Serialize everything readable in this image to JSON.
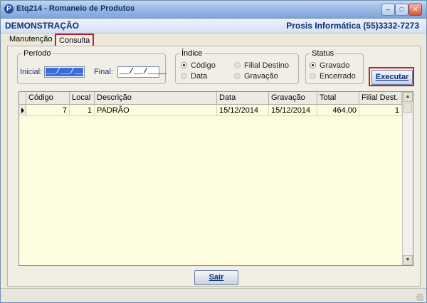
{
  "window": {
    "title": "Etq214 - Romaneio de Produtos",
    "app_icon": "P",
    "minimize": "–",
    "maximize": "□",
    "close": "✕"
  },
  "brand": {
    "left": "DEMONSTRAÇÃO",
    "right": "Prosis Informática (55)3332-7273"
  },
  "tabs": [
    {
      "label": "Manutenção",
      "active": false
    },
    {
      "label": "Consulta",
      "active": true
    }
  ],
  "periodo": {
    "legend": "Período",
    "inicial_label": "Inicial:",
    "inicial_value": "__/__/____",
    "final_label": "Final:",
    "final_value": "__/__/____"
  },
  "indice": {
    "legend": "Índice",
    "options": [
      {
        "label": "Código",
        "checked": true
      },
      {
        "label": "Filial Destino",
        "checked": false
      },
      {
        "label": "Data",
        "checked": false
      },
      {
        "label": "Gravação",
        "checked": false
      }
    ]
  },
  "status": {
    "legend": "Status",
    "options": [
      {
        "label": "Gravado",
        "checked": true
      },
      {
        "label": "Encerrado",
        "checked": false
      }
    ]
  },
  "executar_label": "Executar",
  "grid": {
    "columns": [
      "Código",
      "Local",
      "Descrição",
      "Data",
      "Gravação",
      "Total",
      "Filial Dest."
    ],
    "rows": [
      [
        "7",
        "1",
        "PADRÃO",
        "15/12/2014",
        "15/12/2014",
        "464,00",
        "1"
      ]
    ],
    "scroll_up": "▲",
    "scroll_down": "▼"
  },
  "sair_label": "Sair"
}
